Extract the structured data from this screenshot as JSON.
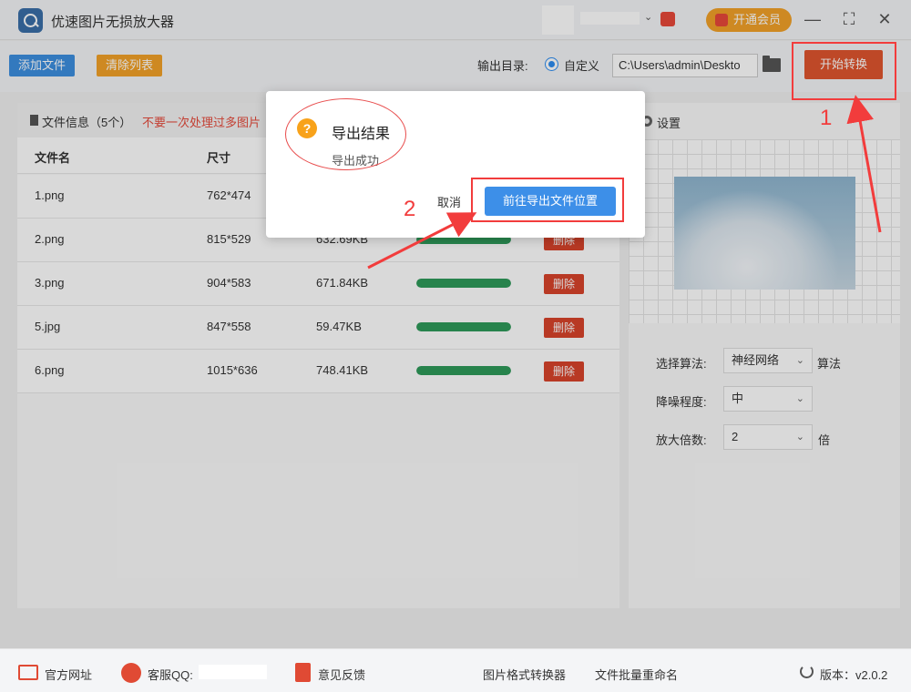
{
  "app": {
    "title": "优速图片无损放大器",
    "vip_label": "开通会员"
  },
  "window": {
    "minimize": "—",
    "maximize": "⛶",
    "close": "✕"
  },
  "toolbar": {
    "add_label": "添加文件",
    "clear_label": "清除列表",
    "output_label": "输出目录:",
    "radio_label": "自定义",
    "path_value": "C:\\Users\\admin\\Deskto",
    "start_label": "开始转换"
  },
  "file_panel": {
    "info": "文件信息（5个）",
    "warning": "不要一次处理过多图片",
    "columns": [
      "文件名",
      "尺寸"
    ],
    "rows": [
      {
        "name": "1.png",
        "size": "762*474",
        "filesize": "",
        "progress": 1.0,
        "delete": "删除"
      },
      {
        "name": "2.png",
        "size": "815*529",
        "filesize": "632.69KB",
        "progress": 1.0,
        "delete": "删除"
      },
      {
        "name": "3.png",
        "size": "904*583",
        "filesize": "671.84KB",
        "progress": 1.0,
        "delete": "删除"
      },
      {
        "name": "5.jpg",
        "size": "847*558",
        "filesize": "59.47KB",
        "progress": 1.0,
        "delete": "删除"
      },
      {
        "name": "6.png",
        "size": "1015*636",
        "filesize": "748.41KB",
        "progress": 1.0,
        "delete": "删除"
      }
    ]
  },
  "settings": {
    "title": "设置",
    "algorithm_label": "选择算法:",
    "algorithm_value": "神经网络",
    "algorithm_suffix": "算法",
    "noise_label": "降噪程度:",
    "noise_value": "中",
    "scale_label": "放大倍数:",
    "scale_value": "2",
    "scale_suffix": "倍"
  },
  "dialog": {
    "title": "导出结果",
    "message": "导出成功",
    "cancel": "取消",
    "go": "前往导出文件位置"
  },
  "annotations": {
    "step1": "1",
    "step2": "2"
  },
  "footer": {
    "website": "官方网址",
    "qq": "客服QQ:",
    "feedback": "意见反馈",
    "converter": "图片格式转换器",
    "rename": "文件批量重命名",
    "version": "版本：v2.0.2"
  }
}
